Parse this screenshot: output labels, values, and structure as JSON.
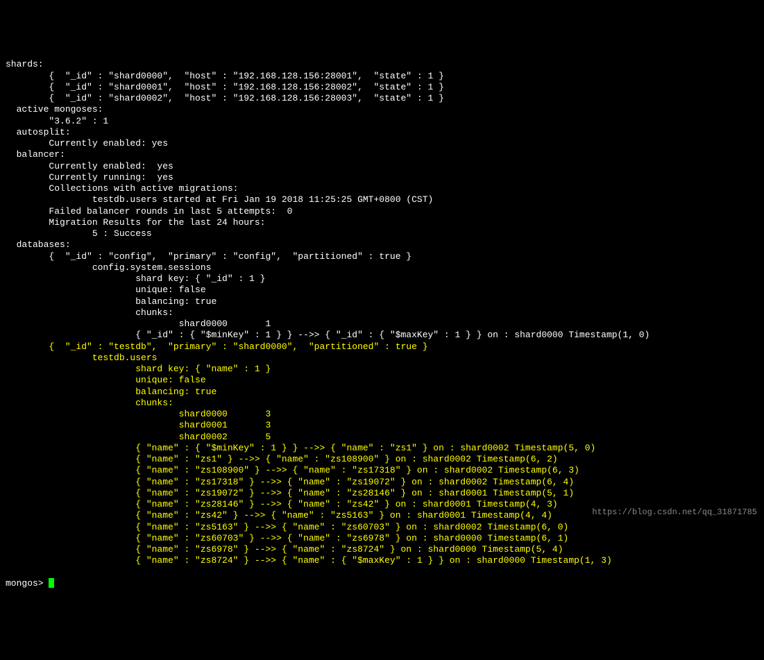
{
  "shards_header": "shards:",
  "shards": [
    "        {  \"_id\" : \"shard0000\",  \"host\" : \"192.168.128.156:28001\",  \"state\" : 1 }",
    "        {  \"_id\" : \"shard0001\",  \"host\" : \"192.168.128.156:28002\",  \"state\" : 1 }",
    "        {  \"_id\" : \"shard0002\",  \"host\" : \"192.168.128.156:28003\",  \"state\" : 1 }"
  ],
  "active_mongoses_header": "  active mongoses:",
  "active_mongoses_line": "        \"3.6.2\" : 1",
  "autosplit_header": "  autosplit:",
  "autosplit_line": "        Currently enabled: yes",
  "balancer_header": "  balancer:",
  "balancer_enabled": "        Currently enabled:  yes",
  "balancer_running": "        Currently running:  yes",
  "balancer_collections": "        Collections with active migrations:",
  "balancer_migration": "                testdb.users started at Fri Jan 19 2018 11:25:25 GMT+0800 (CST)",
  "balancer_failed": "        Failed balancer rounds in last 5 attempts:  0",
  "balancer_results": "        Migration Results for the last 24 hours:",
  "balancer_success": "                5 : Success",
  "databases_header": "  databases:",
  "config_db": "        {  \"_id\" : \"config\",  \"primary\" : \"config\",  \"partitioned\" : true }",
  "config_sessions": "                config.system.sessions",
  "config_shardkey": "                        shard key: { \"_id\" : 1 }",
  "config_unique": "                        unique: false",
  "config_balancing": "                        balancing: true",
  "config_chunks": "                        chunks:",
  "config_shard0000": "                                shard0000       1",
  "config_chunk_range": "                        { \"_id\" : { \"$minKey\" : 1 } } -->> { \"_id\" : { \"$maxKey\" : 1 } } on : shard0000 Timestamp(1, 0)",
  "testdb_db": "        {  \"_id\" : \"testdb\",  \"primary\" : \"shard0000\",  \"partitioned\" : true }",
  "testdb_users": "                testdb.users",
  "testdb_shardkey": "                        shard key: { \"name\" : 1 }",
  "testdb_unique": "                        unique: false",
  "testdb_balancing": "                        balancing: true",
  "testdb_chunks": "                        chunks:",
  "testdb_shard0000": "                                shard0000       3",
  "testdb_shard0001": "                                shard0001       3",
  "testdb_shard0002": "                                shard0002       5",
  "testdb_ranges": [
    "                        { \"name\" : { \"$minKey\" : 1 } } -->> { \"name\" : \"zs1\" } on : shard0002 Timestamp(5, 0)",
    "                        { \"name\" : \"zs1\" } -->> { \"name\" : \"zs108900\" } on : shard0002 Timestamp(6, 2)",
    "                        { \"name\" : \"zs108900\" } -->> { \"name\" : \"zs17318\" } on : shard0002 Timestamp(6, 3)",
    "                        { \"name\" : \"zs17318\" } -->> { \"name\" : \"zs19072\" } on : shard0002 Timestamp(6, 4)",
    "                        { \"name\" : \"zs19072\" } -->> { \"name\" : \"zs28146\" } on : shard0001 Timestamp(5, 1)",
    "                        { \"name\" : \"zs28146\" } -->> { \"name\" : \"zs42\" } on : shard0001 Timestamp(4, 3)",
    "                        { \"name\" : \"zs42\" } -->> { \"name\" : \"zs5163\" } on : shard0001 Timestamp(4, 4)",
    "                        { \"name\" : \"zs5163\" } -->> { \"name\" : \"zs60703\" } on : shard0002 Timestamp(6, 0)",
    "                        { \"name\" : \"zs60703\" } -->> { \"name\" : \"zs6978\" } on : shard0000 Timestamp(6, 1)",
    "                        { \"name\" : \"zs6978\" } -->> { \"name\" : \"zs8724\" } on : shard0000 Timestamp(5, 4)",
    "                        { \"name\" : \"zs8724\" } -->> { \"name\" : { \"$maxKey\" : 1 } } on : shard0000 Timestamp(1, 3)"
  ],
  "prompt": "mongos> ",
  "watermark": "https://blog.csdn.net/qq_31871785"
}
